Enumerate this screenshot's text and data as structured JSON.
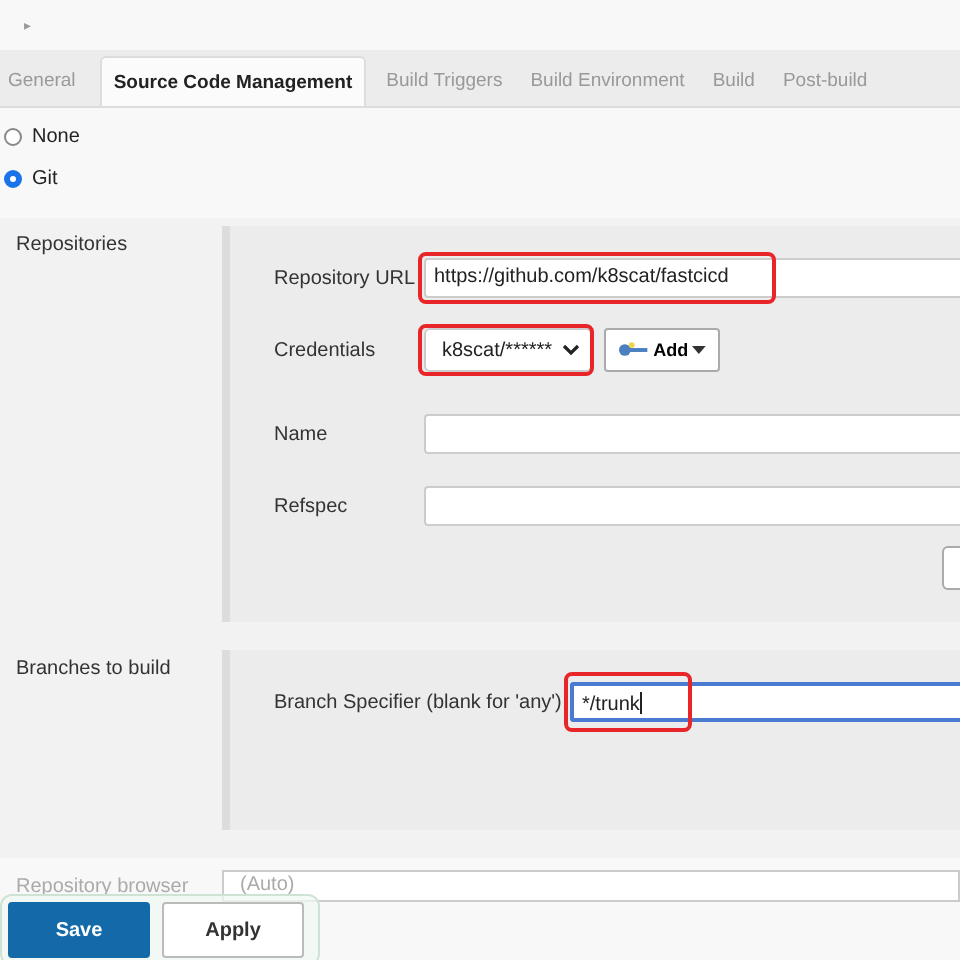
{
  "breadcrumb": {
    "expander": "▸"
  },
  "tabs": [
    {
      "label": "General",
      "selected": false
    },
    {
      "label": "Source Code Management",
      "selected": true
    },
    {
      "label": "Build Triggers",
      "selected": false
    },
    {
      "label": "Build Environment",
      "selected": false
    },
    {
      "label": "Build",
      "selected": false
    },
    {
      "label": "Post-build",
      "selected": false
    }
  ],
  "scm_options": [
    {
      "label": "None",
      "selected": false
    },
    {
      "label": "Git",
      "selected": true
    }
  ],
  "repositories": {
    "label": "Repositories",
    "fields": [
      {
        "kind": "text",
        "label": "Repository URL",
        "value": "https://github.com/k8scat/fastcicd",
        "highlighted": true
      },
      {
        "kind": "select",
        "label": "Credentials",
        "value": "k8scat/******",
        "highlighted": true,
        "add_button": "Add"
      },
      {
        "kind": "text",
        "label": "Name",
        "highlighted": false
      },
      {
        "kind": "text",
        "label": "Refspec",
        "highlighted": false
      }
    ]
  },
  "branches": {
    "label": "Branches to build",
    "fields": [
      {
        "kind": "text",
        "label": "Branch Specifier (blank for 'any')",
        "value": "*/trunk",
        "highlighted": true,
        "focused": true
      }
    ]
  },
  "repository_browser": {
    "label": "Repository browser",
    "value": "(Auto)"
  },
  "buttons": [
    {
      "label": "Save",
      "kind": "primary"
    },
    {
      "label": "Apply",
      "kind": "secondary"
    }
  ]
}
